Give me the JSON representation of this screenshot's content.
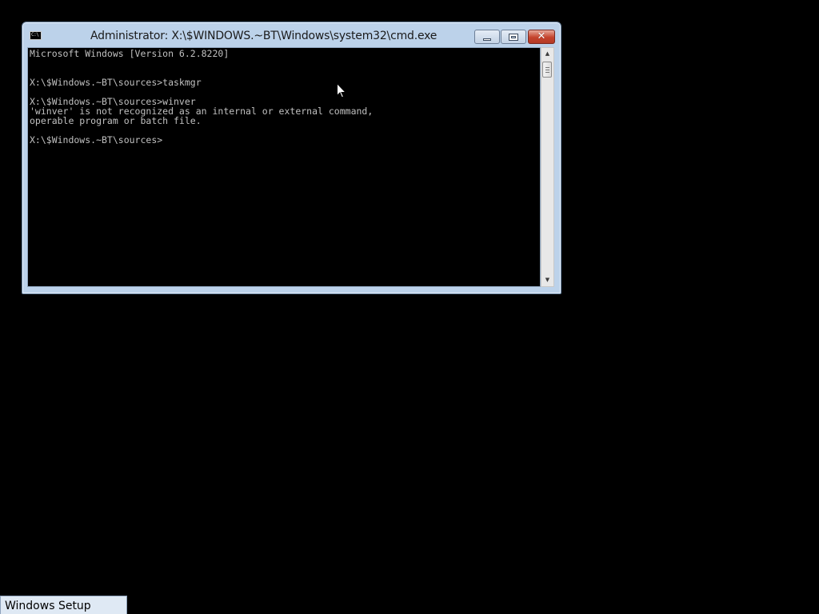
{
  "window": {
    "title": "Administrator: X:\\$WINDOWS.~BT\\Windows\\system32\\cmd.exe",
    "icon": "command-prompt-icon",
    "icon_glyph": "C:\\",
    "buttons": {
      "minimize": "minimize-icon",
      "maximize": "maximize-icon",
      "close_glyph": "✕"
    }
  },
  "console": {
    "lines": [
      "Microsoft Windows [Version 6.2.8220]",
      "",
      "",
      "X:\\$Windows.~BT\\sources>taskmgr",
      "",
      "X:\\$Windows.~BT\\sources>winver",
      "'winver' is not recognized as an internal or external command,",
      "operable program or batch file.",
      "",
      "X:\\$Windows.~BT\\sources>"
    ],
    "text_color": "#c0c0c0",
    "background_color": "#000000"
  },
  "scrollbar": {
    "up_arrow": "▲",
    "down_arrow": "▼"
  },
  "taskbar": {
    "items": [
      {
        "label": "Windows Setup"
      }
    ]
  },
  "colors": {
    "desktop": "#000000",
    "window_frame": "#bcd2ea",
    "close_button": "#c4422c"
  }
}
